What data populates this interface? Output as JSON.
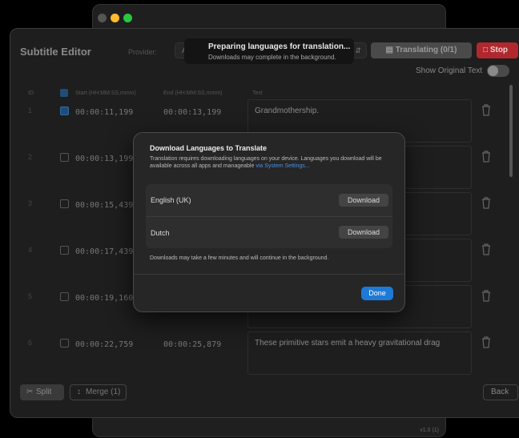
{
  "window": {
    "traffic_lights": {
      "close": "#ff5f57",
      "minimize": "#febc2e",
      "zoom": "#28c840"
    },
    "version": "v1.0 (1)"
  },
  "header": {
    "title": "Subtitle Editor",
    "provider_label": "Provider:",
    "provider_value": "A",
    "translating_label": "Translating (0/1)",
    "stop_label": "Stop",
    "show_original_label": "Show Original Text",
    "show_original_on": false
  },
  "toast": {
    "line1": "Preparing languages for translation...",
    "line2": "Downloads may complete in the background."
  },
  "table": {
    "columns": {
      "id": "ID",
      "start": "Start (HH:MM:SS,mmm)",
      "end": "End (HH:MM:SS,mmm)",
      "text": "Text"
    },
    "rows": [
      {
        "id": "1",
        "checked": true,
        "start": "00:00:11,199",
        "end": "00:00:13,199",
        "text": "Grandmothership."
      },
      {
        "id": "2",
        "checked": false,
        "start": "00:00:13,199",
        "end": "",
        "text": ""
      },
      {
        "id": "3",
        "checked": false,
        "start": "00:00:15,439",
        "end": "",
        "text": ""
      },
      {
        "id": "4",
        "checked": false,
        "start": "00:00:17,439",
        "end": "",
        "text": ""
      },
      {
        "id": "5",
        "checked": false,
        "start": "00:00:19,160",
        "end": "",
        "text": ""
      },
      {
        "id": "6",
        "checked": false,
        "start": "00:00:22,759",
        "end": "00:00:25,879",
        "text": "These primitive stars emit a heavy gravitational drag"
      }
    ]
  },
  "footer": {
    "split_label": "Split",
    "merge_label": "Merge (1)",
    "back_label": "Back"
  },
  "modal": {
    "title": "Download Languages to Translate",
    "description": "Translation requires downloading languages on your device. Languages you download will be available across all apps and manageable",
    "link": "via System Settings...",
    "languages": [
      {
        "name": "English (UK)",
        "action": "Download"
      },
      {
        "name": "Dutch",
        "action": "Download"
      }
    ],
    "note": "Downloads may take a few minutes and will continue in the background.",
    "done_label": "Done"
  },
  "colors": {
    "accent": "#1e7ad7",
    "stop": "#b0282e",
    "link": "#4a90e2"
  }
}
